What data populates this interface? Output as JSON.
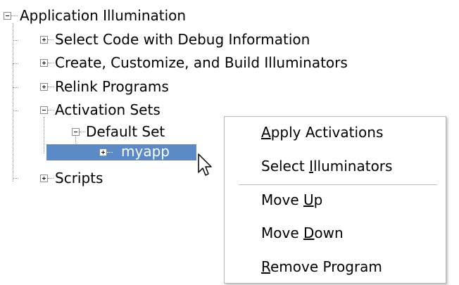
{
  "tree": {
    "root": {
      "label": "Application Illumination"
    },
    "children": [
      {
        "label": "Select Code with Debug Information"
      },
      {
        "label": "Create, Customize, and Build Illuminators"
      },
      {
        "label": "Relink Programs"
      },
      {
        "label": "Activation Sets"
      },
      {
        "label": "Default Set"
      },
      {
        "label": "myapp"
      },
      {
        "label": "Scripts"
      }
    ]
  },
  "context_menu": {
    "items": [
      {
        "pre": "",
        "key": "A",
        "post": "pply Activations"
      },
      {
        "pre": "Select ",
        "key": "I",
        "post": "lluminators"
      },
      {
        "pre": "Move ",
        "key": "U",
        "post": "p"
      },
      {
        "pre": "Move ",
        "key": "D",
        "post": "own"
      },
      {
        "pre": "",
        "key": "R",
        "post": "emove Program"
      }
    ]
  },
  "colors": {
    "selection": "#5b8ac6",
    "tree_lines": "#8c8c8c"
  },
  "icons": {
    "expanded": "minus-box-icon",
    "collapsed": "plus-box-icon",
    "pointer": "arrow-cursor-icon"
  }
}
